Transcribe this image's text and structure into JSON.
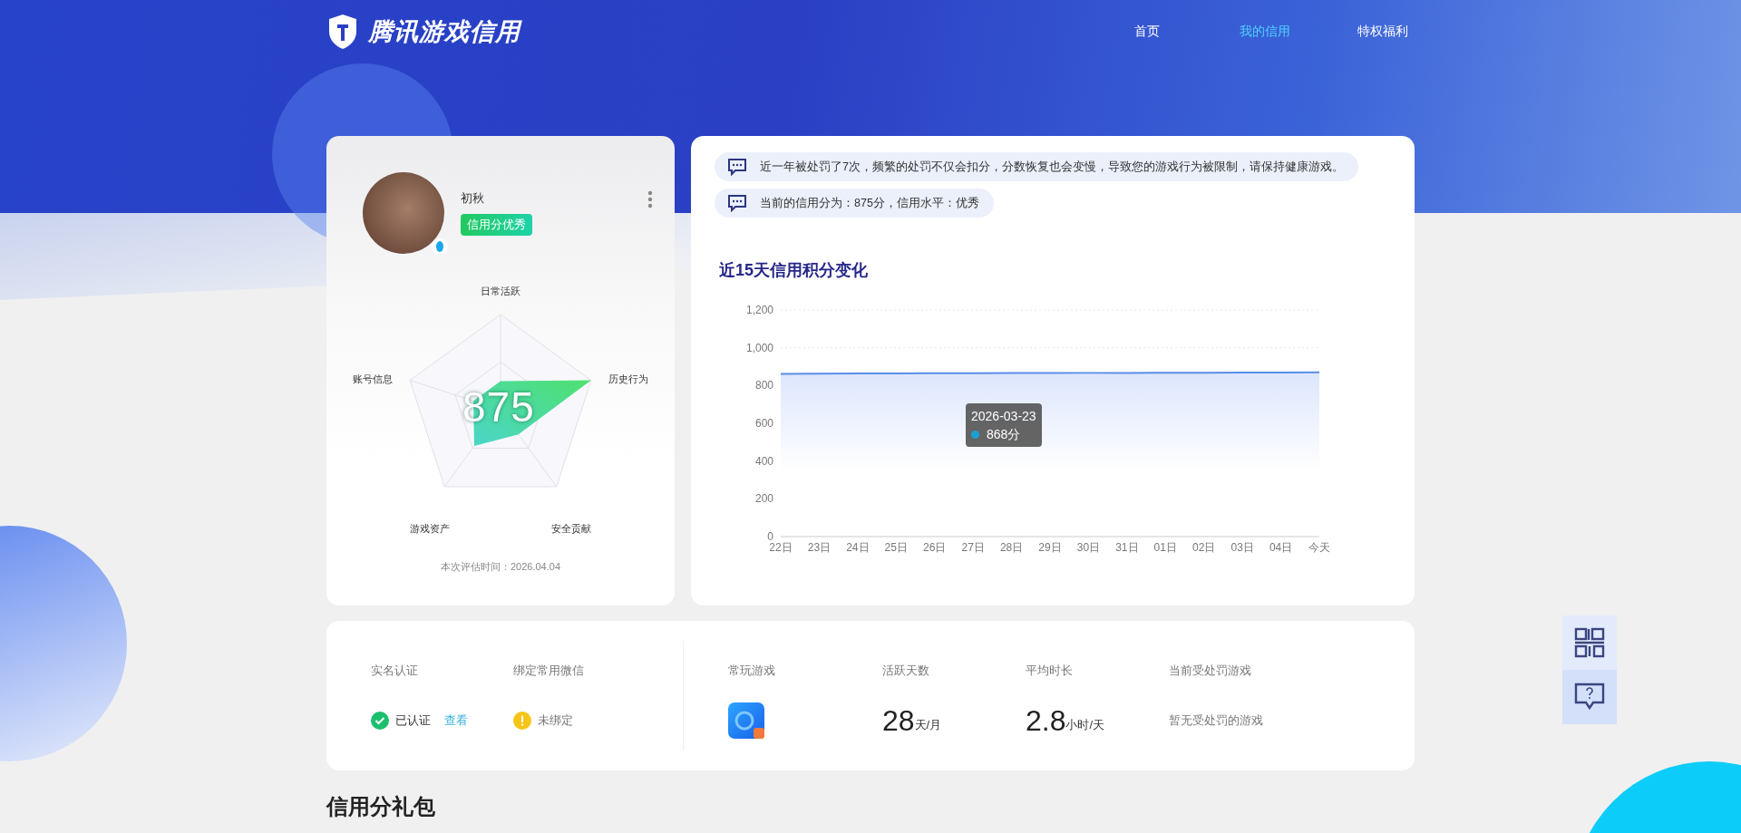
{
  "header": {
    "logo": "腾讯游戏信用",
    "nav": [
      {
        "label": "首页",
        "selected": false
      },
      {
        "label": "我的信用",
        "selected": true
      },
      {
        "label": "特权福利",
        "selected": false
      }
    ]
  },
  "profile": {
    "name": "初秋",
    "badge": "信用分优秀",
    "score": "875",
    "radar_labels": [
      "日常活跃",
      "历史行为",
      "安全贡献",
      "游戏资产",
      "账号信息"
    ],
    "evaluated": "本次评估时间：2026.04.04"
  },
  "notices": [
    "近一年被处罚了7次，频繁的处罚不仅会扣分，分数恢复也会变慢，导致您的游戏行为被限制，请保持健康游戏。",
    "当前的信用分为：875分，信用水平：优秀"
  ],
  "trend": {
    "title": "近15天信用积分变化",
    "tooltip": {
      "date": "2026-03-23",
      "value": "868分"
    },
    "chart_data": {
      "type": "area",
      "categories": [
        "22日",
        "23日",
        "24日",
        "25日",
        "26日",
        "27日",
        "28日",
        "29日",
        "30日",
        "31日",
        "01日",
        "02日",
        "03日",
        "04日",
        "今天"
      ],
      "values": [
        862,
        863,
        864,
        864,
        865,
        865,
        866,
        866,
        867,
        867,
        868,
        868,
        869,
        869,
        870
      ],
      "ylim": [
        0,
        1200
      ],
      "yticks": [
        0,
        200,
        400,
        600,
        800,
        {
          "value": 1000,
          "label": "1,000"
        },
        {
          "value": 1200,
          "label": "1,200"
        }
      ]
    }
  },
  "account": [
    {
      "label": "实名认证",
      "kind": "verified",
      "status": "已认证",
      "link": "查看"
    },
    {
      "label": "绑定常用微信",
      "kind": "warning",
      "status": "未绑定"
    }
  ],
  "stats": [
    {
      "label": "常玩游戏",
      "kind": "game"
    },
    {
      "label": "活跃天数",
      "kind": "number",
      "value": "28",
      "unit": "天/月"
    },
    {
      "label": "平均时长",
      "kind": "number",
      "value": "2.8",
      "unit": "小时/天"
    },
    {
      "label": "当前受处罚游戏",
      "kind": "text",
      "value": "暂无受处罚的游戏"
    }
  ],
  "gift_title": "信用分礼包"
}
